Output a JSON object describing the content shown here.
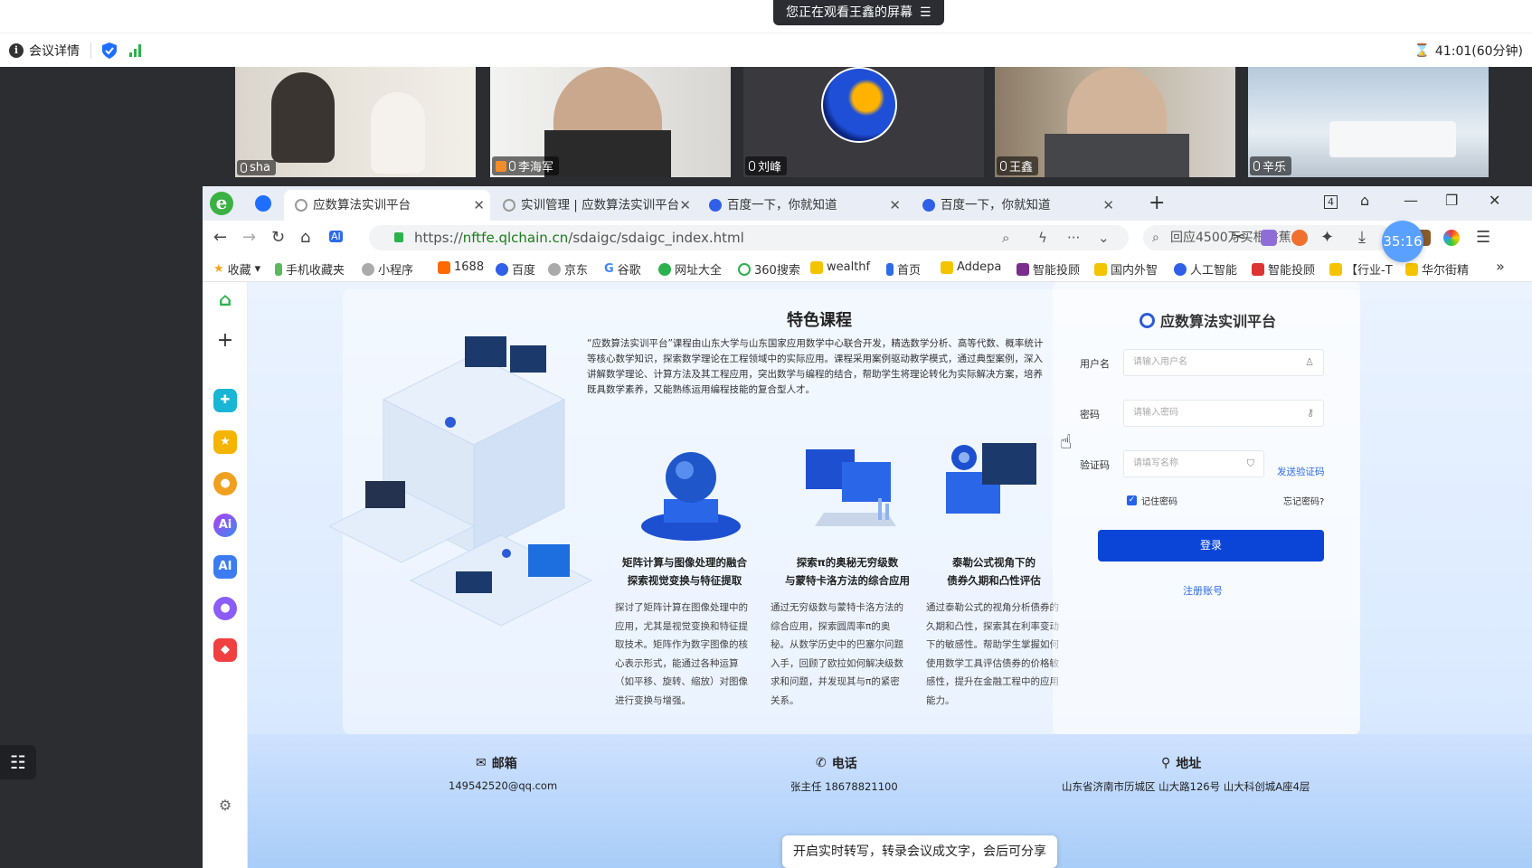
{
  "meeting": {
    "share_banner": "您正在观看王鑫的屏幕",
    "details_label": "会议详情",
    "timer": "41:01(60分钟)",
    "participants": [
      {
        "name": "sha"
      },
      {
        "name": "李海军"
      },
      {
        "name": "刘峰"
      },
      {
        "name": "王鑫"
      },
      {
        "name": "辛乐"
      }
    ],
    "caption_prompt": "开启实时转写，转录会议成文字，会后可分享"
  },
  "browser": {
    "tabs": [
      {
        "label": "应数算法实训平台"
      },
      {
        "label": "实训管理 | 应数算法实训平台"
      },
      {
        "label": "百度一下，你就知道"
      },
      {
        "label": "百度一下，你就知道"
      }
    ],
    "tab_count_badge": "4",
    "timer_bubble": "35:16",
    "url_prefix": "https://",
    "url_host": "nftfe.qlchain.cn",
    "url_path": "/sdaigc/sdaigc_index.html",
    "search_text": "回应4500万买根香蕉",
    "bookmarks": [
      "收藏",
      "手机收藏夹",
      "小程序",
      "1688",
      "百度",
      "京东",
      "谷歌",
      "网址大全",
      "360搜索",
      "wealthf",
      "首页",
      "Addepa",
      "智能投顾",
      "国内外智",
      "人工智能",
      "智能投顾",
      "【行业-T",
      "华尔街精"
    ]
  },
  "page": {
    "section_title": "特色课程",
    "intro": "“应数算法实训平台”课程由山东大学与山东国家应用数学中心联合开发，精选数学分析、高等代数、概率统计等核心数学知识，探索数学理论在工程领域中的实际应用。课程采用案例驱动教学模式，通过典型案例，深入讲解数学理论、计算方法及其工程应用，突出数学与编程的结合，帮助学生将理论转化为实际解决方案，培养既具数学素养，又能熟练运用编程技能的复合型人才。",
    "features": [
      {
        "title_line1": "矩阵计算与图像处理的融合",
        "title_line2": "探索视觉变换与特征提取",
        "desc": "探讨了矩阵计算在图像处理中的应用，尤其是视觉变换和特征提取技术。矩阵作为数字图像的核心表示形式，能通过各种运算（如平移、旋转、缩放）对图像进行变换与增强。"
      },
      {
        "title_line1": "探索π的奥秘无穷级数",
        "title_line2": "与蒙特卡洛方法的综合应用",
        "desc": "通过无穷级数与蒙特卡洛方法的综合应用，探索圆周率π的奥秘。从数学历史中的巴塞尔问题入手，回顾了欧拉如何解决级数求和问题，并发现其与π的紧密关系。"
      },
      {
        "title_line1": "泰勒公式视角下的",
        "title_line2": "债券久期和凸性评估",
        "desc": "通过泰勒公式的视角分析债券的久期和凸性，探索其在利率变动下的敏感性。帮助学生掌握如何使用数学工具评估债券的价格敏感性，提升在金融工程中的应用能力。"
      }
    ],
    "login": {
      "title": "应数算法实训平台",
      "username_label": "用户名",
      "username_placeholder": "请输入用户名",
      "password_label": "密码",
      "password_placeholder": "请输入密码",
      "code_label": "验证码",
      "code_placeholder": "请填写名称",
      "send_code": "发送验证码",
      "remember": "记住密码",
      "forgot": "忘记密码?",
      "submit": "登录",
      "register": "注册账号"
    },
    "footer": {
      "email_label": "邮箱",
      "email": "149542520@qq.com",
      "phone_label": "电话",
      "phone": "张主任 18678821100",
      "address_label": "地址",
      "address": "山东省济南市历城区 山大路126号 山大科创城A座4层"
    }
  },
  "colors": {
    "accent": "#0a45d8",
    "meeting_bg": "#2b2d31",
    "active_speaker": "#22c55e"
  }
}
